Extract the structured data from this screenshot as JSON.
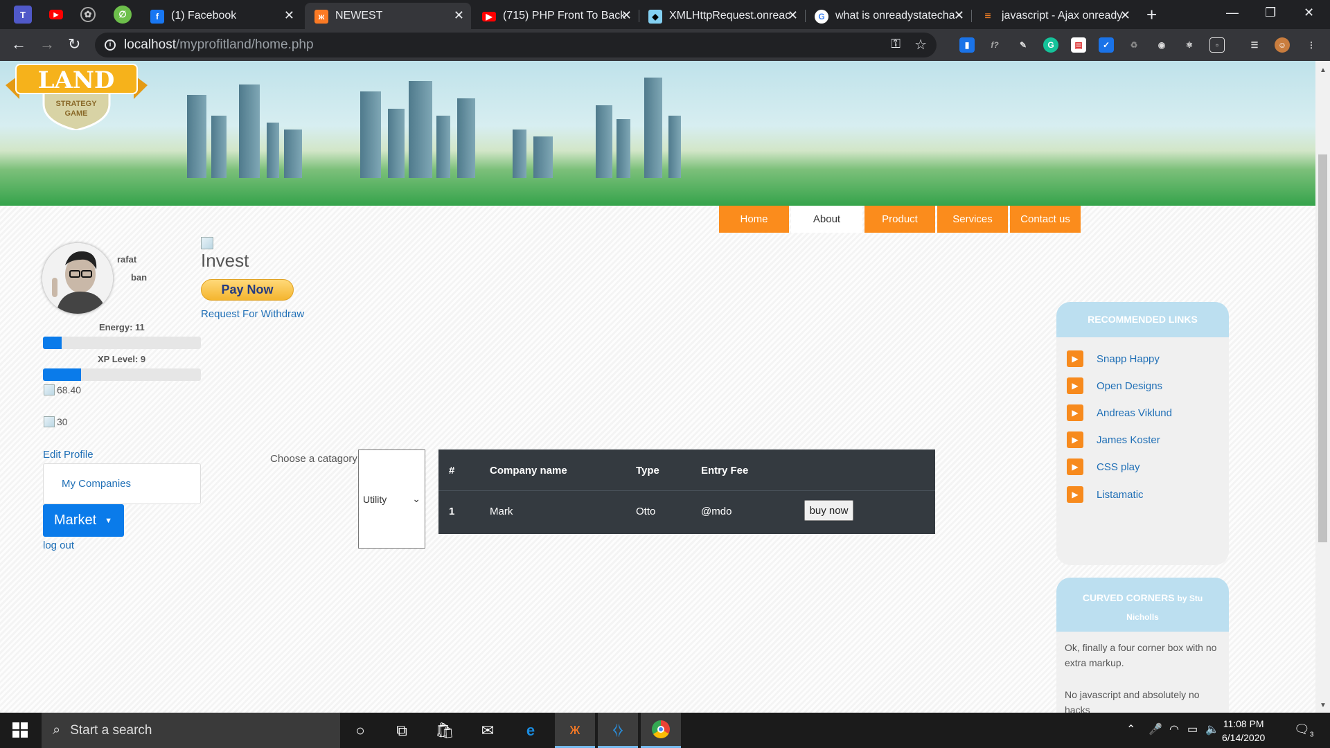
{
  "browser": {
    "pinned_tabs": [
      "teams-icon",
      "youtube-icon",
      "openai-icon",
      "tool-icon"
    ],
    "tabs": [
      {
        "title": "(1) Facebook",
        "icon": "facebook-icon",
        "color": "#1877f2"
      },
      {
        "title": "NEWEST",
        "icon": "xampp-icon",
        "color": "#fb7a24",
        "active": true
      },
      {
        "title": "(715) PHP Front To Back",
        "icon": "youtube-icon",
        "color": "#ff0000"
      },
      {
        "title": "XMLHttpRequest.onreac",
        "icon": "mdn-icon",
        "color": "#83d0f2"
      },
      {
        "title": "what is onreadystatecha",
        "icon": "google-icon",
        "color": "#ffffff"
      },
      {
        "title": "javascript - Ajax onready",
        "icon": "stackoverflow-icon",
        "color": "#f48024"
      }
    ],
    "url_host": "localhost",
    "url_path": "/myprofitland/home.php"
  },
  "site": {
    "logo_title": "LAND",
    "logo_sub1": "STRATEGY",
    "logo_sub2": "GAME",
    "nav": [
      {
        "label": "Home",
        "selected": false
      },
      {
        "label": "About",
        "selected": true
      },
      {
        "label": "Product",
        "selected": false
      },
      {
        "label": "Services",
        "selected": false
      },
      {
        "label": "Contact us",
        "selected": false
      }
    ]
  },
  "profile": {
    "first_name": "rafat",
    "last_name": "ban",
    "energy_label": "Energy: 11",
    "energy_fraction": 0.12,
    "xp_label": "XP Level: 9",
    "xp_fraction": 0.24,
    "money": "68.40",
    "coins": "30",
    "edit_profile": "Edit Profile",
    "my_companies": "My Companies",
    "market": "Market",
    "logout": "log out"
  },
  "invest": {
    "title": "Invest",
    "pay_now": "Pay Now",
    "withdraw": "Request For Withdraw"
  },
  "companies": {
    "choose_label": "Choose a catagory:",
    "category": "Utility",
    "headers": [
      "#",
      "Company name",
      "Type",
      "Entry Fee"
    ],
    "rows": [
      {
        "num": "1",
        "name": "Mark",
        "type": "Otto",
        "fee": "@mdo",
        "action": "buy now"
      }
    ]
  },
  "sidebar": {
    "recommended_title": "RECOMMENDED LINKS",
    "links": [
      "Snapp Happy",
      "Open Designs",
      "Andreas Viklund",
      "James Koster",
      "CSS play",
      "Listamatic"
    ],
    "curved_title": "CURVED CORNERS",
    "curved_by": "by Stu",
    "curved_author": "Nicholls",
    "curved_text1": "Ok, finally a four corner box with no extra markup.",
    "curved_text2": "No javascript and absolutely no hacks"
  },
  "taskbar": {
    "search_placeholder": "Start a search",
    "time": "11:08 PM",
    "date": "6/14/2020",
    "notifications": "3"
  }
}
